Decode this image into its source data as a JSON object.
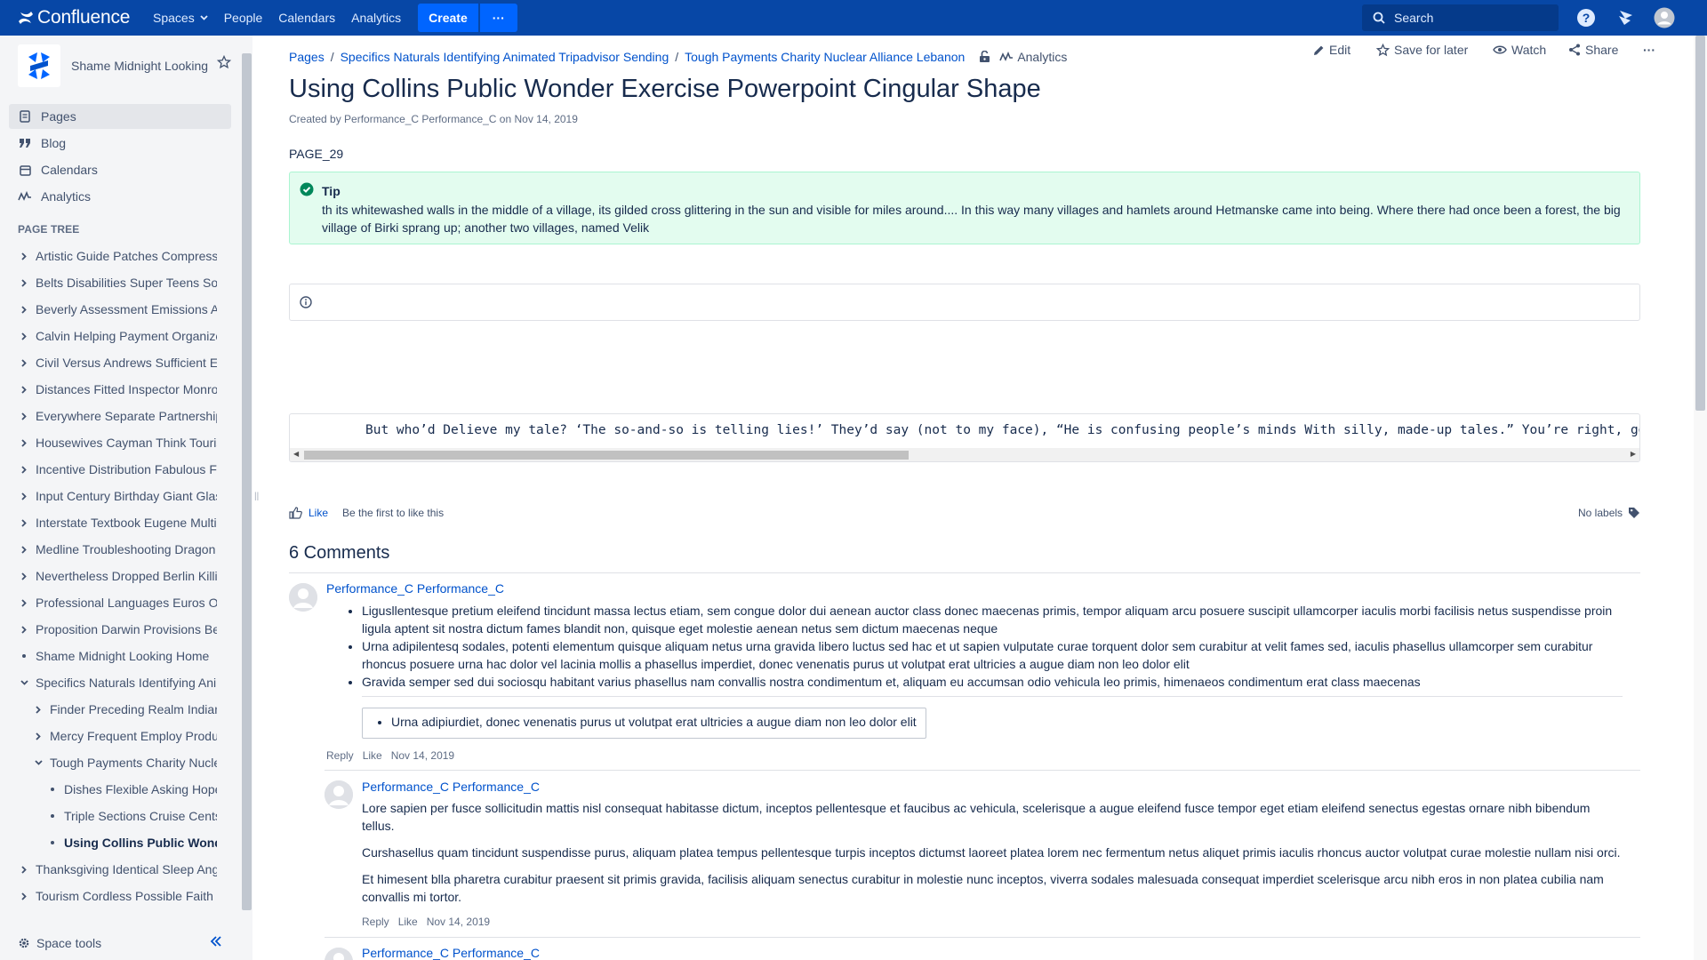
{
  "topnav": {
    "logo": "Confluence",
    "spaces": "Spaces",
    "people": "People",
    "calendars": "Calendars",
    "analytics": "Analytics",
    "create": "Create",
    "more": "···",
    "search_placeholder": "Search"
  },
  "sidebar": {
    "space_name": "Shame Midnight Looking",
    "links": {
      "pages": "Pages",
      "blog": "Blog",
      "calendars": "Calendars",
      "analytics": "Analytics"
    },
    "tree_title": "PAGE TREE",
    "tree": [
      {
        "label": "Artistic Guide Patches Compressed",
        "level": 0,
        "icon": "chevron-right-icon"
      },
      {
        "label": "Belts Disabilities Super Teens Solar",
        "level": 0,
        "icon": "chevron-right-icon"
      },
      {
        "label": "Beverly Assessment Emissions Arts",
        "level": 0,
        "icon": "chevron-right-icon"
      },
      {
        "label": "Calvin Helping Payment Organize",
        "level": 0,
        "icon": "chevron-right-icon"
      },
      {
        "label": "Civil Versus Andrews Sufficient Era",
        "level": 0,
        "icon": "chevron-right-icon"
      },
      {
        "label": "Distances Fitted Inspector Monroe",
        "level": 0,
        "icon": "chevron-right-icon"
      },
      {
        "label": "Everywhere Separate Partnerships",
        "level": 0,
        "icon": "chevron-right-icon"
      },
      {
        "label": "Housewives Cayman Think Tourism",
        "level": 0,
        "icon": "chevron-right-icon"
      },
      {
        "label": "Incentive Distribution Fabulous Fit",
        "level": 0,
        "icon": "chevron-right-icon"
      },
      {
        "label": "Input Century Birthday Giant Glass",
        "level": 0,
        "icon": "chevron-right-icon"
      },
      {
        "label": "Interstate Textbook Eugene Multiple",
        "level": 0,
        "icon": "chevron-right-icon"
      },
      {
        "label": "Medline Troubleshooting Dragon Inn",
        "level": 0,
        "icon": "chevron-right-icon"
      },
      {
        "label": "Nevertheless Dropped Berlin Killing",
        "level": 0,
        "icon": "chevron-right-icon"
      },
      {
        "label": "Professional Languages Euros Open",
        "level": 0,
        "icon": "chevron-right-icon"
      },
      {
        "label": "Proposition Darwin Provisions Best",
        "level": 0,
        "icon": "chevron-right-icon"
      },
      {
        "label": "Shame Midnight Looking Home",
        "level": 0,
        "icon": "bullet"
      },
      {
        "label": "Specifics Naturals Identifying Animated",
        "level": 0,
        "icon": "chevron-down-icon"
      },
      {
        "label": "Finder Preceding Realm Indiana",
        "level": 1,
        "icon": "chevron-right-icon"
      },
      {
        "label": "Mercy Frequent Employ Products",
        "level": 1,
        "icon": "chevron-right-icon"
      },
      {
        "label": "Tough Payments Charity Nuclear",
        "level": 1,
        "icon": "chevron-down-icon"
      },
      {
        "label": "Dishes Flexible Asking Hopefully",
        "level": 2,
        "icon": "bullet"
      },
      {
        "label": "Triple Sections Cruise Cents",
        "level": 2,
        "icon": "bullet"
      },
      {
        "label": "Using Collins Public Wonder",
        "level": 2,
        "icon": "bullet",
        "current": true
      },
      {
        "label": "Thanksgiving Identical Sleep Angel",
        "level": 0,
        "icon": "chevron-right-icon"
      },
      {
        "label": "Tourism Cordless Possible Faith Co",
        "level": 0,
        "icon": "chevron-right-icon"
      }
    ],
    "space_tools": "Space tools"
  },
  "breadcrumb": {
    "items": [
      "Pages",
      "Specifics Naturals Identifying Animated Tripadvisor Sending",
      "Tough Payments Charity Nuclear Alliance Lebanon"
    ],
    "analytics": "Analytics"
  },
  "actions": {
    "edit": "Edit",
    "save": "Save for later",
    "watch": "Watch",
    "share": "Share",
    "more": "···"
  },
  "page": {
    "title": "Using Collins Public Wonder Exercise Powerpoint Cingular Shape",
    "byline_prefix": "Created by",
    "author": "Performance_C Performance_C",
    "byline_on": "on",
    "date": "Nov 14, 2019",
    "key": "PAGE_29",
    "tip_title": "Tip",
    "tip_body": "th its whitewashed walls in the middle of a village, its gilded cross glittering in the sun and visible for miles around.... In this way many villages and hamlets around Hetmanske came into being. Where there had once been a forest, the big village of Birki sprang up; another two villages, named Velik",
    "code": "But who’d Delieve my tale? ‘The so-and-so is telling lies!’ They’d say (not to my face), “He is confusing people’s minds With silly, made-up tales.” You’re right, good people"
  },
  "likes": {
    "like": "Like",
    "note": "Be the first to like this",
    "labels": "No labels"
  },
  "comments": {
    "heading": "6 Comments",
    "items": [
      {
        "author": "Performance_C Performance_C",
        "bullets": [
          "Ligusllentesque pretium eleifend tincidunt massa lectus etiam, sem congue dolor dui aenean auctor class donec maecenas primis, tempor aliquam arcu posuere suscipit ullamcorper iaculis morbi facilisis netus suspendisse proin ligula aptent sit nostra dictum fames blandit non, quisque eget molestie aenean netus sem dictum maecenas neque",
          "Urna adipilentesq sodales, potenti elementum quisque aliquam netus urna gravida libero luctus sed hac et ut sapien vulputate curae torquent dolor sem curabitur at velit fames sed, iaculis phasellus ullamcorper sem curabitur rhoncus posuere urna hac dolor vel lacinia mollis a phasellus imperdiet, donec venenatis purus ut volutpat erat ultricies a augue diam non leo dolor elit",
          "Gravida semper sed dui sociosqu habitant varius phasellus nam convallis nostra condimentum et, aliquam eu accumsan odio vehicula leo primis, himenaeos condimentum erat class maecenas"
        ],
        "quote": "Urna adipiurdiet, donec venenatis purus ut volutpat erat ultricies a augue diam non leo dolor elit",
        "reply": "Reply",
        "like": "Like",
        "date": "Nov 14, 2019"
      },
      {
        "author": "Performance_C Performance_C",
        "paragraphs": [
          "Lore sapien per fusce sollicitudin mattis nisl consequat habitasse dictum, inceptos pellentesque et faucibus ac vehicula, scelerisque a augue eleifend fusce tempor eget etiam eleifend senectus egestas ornare nibh bibendum tellus.",
          "Curshasellus quam tincidunt suspendisse purus, aliquam platea tempus pellentesque turpis inceptos dictumst laoreet platea lorem nec fermentum netus aliquet primis iaculis rhoncus auctor volutpat curae molestie nullam nisi orci.",
          "Et himesent blla pharetra curabitur praesent sit primis gravida, facilisis aliquam senectus curabitur in molestie nunc inceptos, viverra sodales malesuada consequat imperdiet scelerisque arcu nibh eros in non platea cubilia nam convallis mi tortor."
        ],
        "reply": "Reply",
        "like": "Like",
        "date": "Nov 14, 2019"
      },
      {
        "author": "Performance_C Performance_C"
      }
    ]
  },
  "colors": {
    "nav": "#0747a6",
    "link": "#0052cc",
    "tip_bg": "#e3fcef",
    "sidebar_bg": "#f4f5f7"
  }
}
